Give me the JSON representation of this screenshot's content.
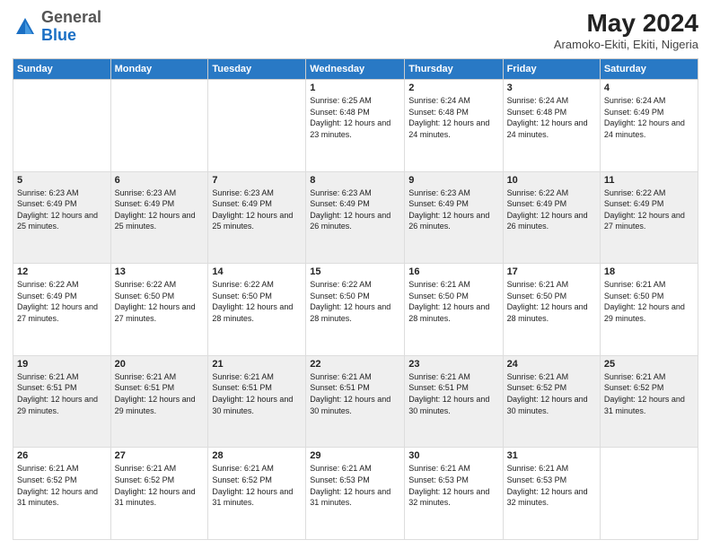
{
  "header": {
    "logo_general": "General",
    "logo_blue": "Blue",
    "month_year": "May 2024",
    "location": "Aramoko-Ekiti, Ekiti, Nigeria"
  },
  "days_of_week": [
    "Sunday",
    "Monday",
    "Tuesday",
    "Wednesday",
    "Thursday",
    "Friday",
    "Saturday"
  ],
  "weeks": [
    [
      {
        "num": "",
        "sunrise": "",
        "sunset": "",
        "daylight": ""
      },
      {
        "num": "",
        "sunrise": "",
        "sunset": "",
        "daylight": ""
      },
      {
        "num": "",
        "sunrise": "",
        "sunset": "",
        "daylight": ""
      },
      {
        "num": "1",
        "sunrise": "Sunrise: 6:25 AM",
        "sunset": "Sunset: 6:48 PM",
        "daylight": "Daylight: 12 hours and 23 minutes."
      },
      {
        "num": "2",
        "sunrise": "Sunrise: 6:24 AM",
        "sunset": "Sunset: 6:48 PM",
        "daylight": "Daylight: 12 hours and 24 minutes."
      },
      {
        "num": "3",
        "sunrise": "Sunrise: 6:24 AM",
        "sunset": "Sunset: 6:48 PM",
        "daylight": "Daylight: 12 hours and 24 minutes."
      },
      {
        "num": "4",
        "sunrise": "Sunrise: 6:24 AM",
        "sunset": "Sunset: 6:49 PM",
        "daylight": "Daylight: 12 hours and 24 minutes."
      }
    ],
    [
      {
        "num": "5",
        "sunrise": "Sunrise: 6:23 AM",
        "sunset": "Sunset: 6:49 PM",
        "daylight": "Daylight: 12 hours and 25 minutes."
      },
      {
        "num": "6",
        "sunrise": "Sunrise: 6:23 AM",
        "sunset": "Sunset: 6:49 PM",
        "daylight": "Daylight: 12 hours and 25 minutes."
      },
      {
        "num": "7",
        "sunrise": "Sunrise: 6:23 AM",
        "sunset": "Sunset: 6:49 PM",
        "daylight": "Daylight: 12 hours and 25 minutes."
      },
      {
        "num": "8",
        "sunrise": "Sunrise: 6:23 AM",
        "sunset": "Sunset: 6:49 PM",
        "daylight": "Daylight: 12 hours and 26 minutes."
      },
      {
        "num": "9",
        "sunrise": "Sunrise: 6:23 AM",
        "sunset": "Sunset: 6:49 PM",
        "daylight": "Daylight: 12 hours and 26 minutes."
      },
      {
        "num": "10",
        "sunrise": "Sunrise: 6:22 AM",
        "sunset": "Sunset: 6:49 PM",
        "daylight": "Daylight: 12 hours and 26 minutes."
      },
      {
        "num": "11",
        "sunrise": "Sunrise: 6:22 AM",
        "sunset": "Sunset: 6:49 PM",
        "daylight": "Daylight: 12 hours and 27 minutes."
      }
    ],
    [
      {
        "num": "12",
        "sunrise": "Sunrise: 6:22 AM",
        "sunset": "Sunset: 6:49 PM",
        "daylight": "Daylight: 12 hours and 27 minutes."
      },
      {
        "num": "13",
        "sunrise": "Sunrise: 6:22 AM",
        "sunset": "Sunset: 6:50 PM",
        "daylight": "Daylight: 12 hours and 27 minutes."
      },
      {
        "num": "14",
        "sunrise": "Sunrise: 6:22 AM",
        "sunset": "Sunset: 6:50 PM",
        "daylight": "Daylight: 12 hours and 28 minutes."
      },
      {
        "num": "15",
        "sunrise": "Sunrise: 6:22 AM",
        "sunset": "Sunset: 6:50 PM",
        "daylight": "Daylight: 12 hours and 28 minutes."
      },
      {
        "num": "16",
        "sunrise": "Sunrise: 6:21 AM",
        "sunset": "Sunset: 6:50 PM",
        "daylight": "Daylight: 12 hours and 28 minutes."
      },
      {
        "num": "17",
        "sunrise": "Sunrise: 6:21 AM",
        "sunset": "Sunset: 6:50 PM",
        "daylight": "Daylight: 12 hours and 28 minutes."
      },
      {
        "num": "18",
        "sunrise": "Sunrise: 6:21 AM",
        "sunset": "Sunset: 6:50 PM",
        "daylight": "Daylight: 12 hours and 29 minutes."
      }
    ],
    [
      {
        "num": "19",
        "sunrise": "Sunrise: 6:21 AM",
        "sunset": "Sunset: 6:51 PM",
        "daylight": "Daylight: 12 hours and 29 minutes."
      },
      {
        "num": "20",
        "sunrise": "Sunrise: 6:21 AM",
        "sunset": "Sunset: 6:51 PM",
        "daylight": "Daylight: 12 hours and 29 minutes."
      },
      {
        "num": "21",
        "sunrise": "Sunrise: 6:21 AM",
        "sunset": "Sunset: 6:51 PM",
        "daylight": "Daylight: 12 hours and 30 minutes."
      },
      {
        "num": "22",
        "sunrise": "Sunrise: 6:21 AM",
        "sunset": "Sunset: 6:51 PM",
        "daylight": "Daylight: 12 hours and 30 minutes."
      },
      {
        "num": "23",
        "sunrise": "Sunrise: 6:21 AM",
        "sunset": "Sunset: 6:51 PM",
        "daylight": "Daylight: 12 hours and 30 minutes."
      },
      {
        "num": "24",
        "sunrise": "Sunrise: 6:21 AM",
        "sunset": "Sunset: 6:52 PM",
        "daylight": "Daylight: 12 hours and 30 minutes."
      },
      {
        "num": "25",
        "sunrise": "Sunrise: 6:21 AM",
        "sunset": "Sunset: 6:52 PM",
        "daylight": "Daylight: 12 hours and 31 minutes."
      }
    ],
    [
      {
        "num": "26",
        "sunrise": "Sunrise: 6:21 AM",
        "sunset": "Sunset: 6:52 PM",
        "daylight": "Daylight: 12 hours and 31 minutes."
      },
      {
        "num": "27",
        "sunrise": "Sunrise: 6:21 AM",
        "sunset": "Sunset: 6:52 PM",
        "daylight": "Daylight: 12 hours and 31 minutes."
      },
      {
        "num": "28",
        "sunrise": "Sunrise: 6:21 AM",
        "sunset": "Sunset: 6:52 PM",
        "daylight": "Daylight: 12 hours and 31 minutes."
      },
      {
        "num": "29",
        "sunrise": "Sunrise: 6:21 AM",
        "sunset": "Sunset: 6:53 PM",
        "daylight": "Daylight: 12 hours and 31 minutes."
      },
      {
        "num": "30",
        "sunrise": "Sunrise: 6:21 AM",
        "sunset": "Sunset: 6:53 PM",
        "daylight": "Daylight: 12 hours and 32 minutes."
      },
      {
        "num": "31",
        "sunrise": "Sunrise: 6:21 AM",
        "sunset": "Sunset: 6:53 PM",
        "daylight": "Daylight: 12 hours and 32 minutes."
      },
      {
        "num": "",
        "sunrise": "",
        "sunset": "",
        "daylight": ""
      }
    ]
  ]
}
